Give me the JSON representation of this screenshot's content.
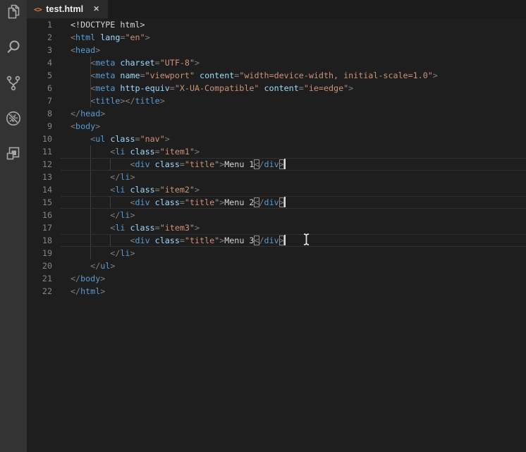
{
  "activity_bar": {
    "icons": [
      {
        "name": "explorer-icon"
      },
      {
        "name": "search-icon"
      },
      {
        "name": "source-control-icon"
      },
      {
        "name": "debug-icon"
      },
      {
        "name": "extensions-icon"
      }
    ]
  },
  "tab_bar": {
    "tabs": [
      {
        "label": "test.html",
        "icon_glyph": "<>",
        "close_glyph": "✕",
        "active": true
      }
    ]
  },
  "pointer": {
    "shape": "text-i-beam"
  },
  "colors": {
    "editor_bg": "#1e1e1e",
    "activity_bar_bg": "#333333",
    "tabbar_bg": "#1b1b1c",
    "active_tab_bg": "#2a2a2b",
    "tag": "#569cd6",
    "attribute": "#9cdcfe",
    "string": "#ce9178",
    "punctuation": "#808080",
    "text": "#d4d4d4",
    "line_number": "#858585"
  },
  "editor": {
    "language": "html",
    "lines": [
      {
        "n": 1,
        "guides": [],
        "active": false,
        "tokens": [
          {
            "t": "<!DOCTYPE html>",
            "c": "plain"
          }
        ]
      },
      {
        "n": 2,
        "guides": [],
        "active": false,
        "tokens": [
          {
            "t": "<",
            "c": "punc"
          },
          {
            "t": "html",
            "c": "tag"
          },
          {
            "t": " ",
            "c": "plain"
          },
          {
            "t": "lang",
            "c": "attr"
          },
          {
            "t": "=",
            "c": "punc"
          },
          {
            "t": "\"en\"",
            "c": "str"
          },
          {
            "t": ">",
            "c": "punc"
          }
        ]
      },
      {
        "n": 3,
        "guides": [],
        "active": false,
        "tokens": [
          {
            "t": "<",
            "c": "punc"
          },
          {
            "t": "head",
            "c": "tag"
          },
          {
            "t": ">",
            "c": "punc"
          }
        ]
      },
      {
        "n": 4,
        "guides": [
          1
        ],
        "active": false,
        "tokens": [
          {
            "t": "    ",
            "c": "plain"
          },
          {
            "t": "<",
            "c": "punc"
          },
          {
            "t": "meta",
            "c": "tag"
          },
          {
            "t": " ",
            "c": "plain"
          },
          {
            "t": "charset",
            "c": "attr"
          },
          {
            "t": "=",
            "c": "punc"
          },
          {
            "t": "\"UTF-8\"",
            "c": "str"
          },
          {
            "t": ">",
            "c": "punc"
          }
        ]
      },
      {
        "n": 5,
        "guides": [
          1
        ],
        "active": false,
        "tokens": [
          {
            "t": "    ",
            "c": "plain"
          },
          {
            "t": "<",
            "c": "punc"
          },
          {
            "t": "meta",
            "c": "tag"
          },
          {
            "t": " ",
            "c": "plain"
          },
          {
            "t": "name",
            "c": "attr"
          },
          {
            "t": "=",
            "c": "punc"
          },
          {
            "t": "\"viewport\"",
            "c": "str"
          },
          {
            "t": " ",
            "c": "plain"
          },
          {
            "t": "content",
            "c": "attr"
          },
          {
            "t": "=",
            "c": "punc"
          },
          {
            "t": "\"width=device-width, initial-scale=1.0\"",
            "c": "str"
          },
          {
            "t": ">",
            "c": "punc"
          }
        ]
      },
      {
        "n": 6,
        "guides": [
          1
        ],
        "active": false,
        "tokens": [
          {
            "t": "    ",
            "c": "plain"
          },
          {
            "t": "<",
            "c": "punc"
          },
          {
            "t": "meta",
            "c": "tag"
          },
          {
            "t": " ",
            "c": "plain"
          },
          {
            "t": "http-equiv",
            "c": "attr"
          },
          {
            "t": "=",
            "c": "punc"
          },
          {
            "t": "\"X-UA-Compatible\"",
            "c": "str"
          },
          {
            "t": " ",
            "c": "plain"
          },
          {
            "t": "content",
            "c": "attr"
          },
          {
            "t": "=",
            "c": "punc"
          },
          {
            "t": "\"ie=edge\"",
            "c": "str"
          },
          {
            "t": ">",
            "c": "punc"
          }
        ]
      },
      {
        "n": 7,
        "guides": [
          1
        ],
        "active": false,
        "tokens": [
          {
            "t": "    ",
            "c": "plain"
          },
          {
            "t": "<",
            "c": "punc"
          },
          {
            "t": "title",
            "c": "tag"
          },
          {
            "t": "></",
            "c": "punc"
          },
          {
            "t": "title",
            "c": "tag"
          },
          {
            "t": ">",
            "c": "punc"
          }
        ]
      },
      {
        "n": 8,
        "guides": [],
        "active": false,
        "tokens": [
          {
            "t": "</",
            "c": "punc"
          },
          {
            "t": "head",
            "c": "tag"
          },
          {
            "t": ">",
            "c": "punc"
          }
        ]
      },
      {
        "n": 9,
        "guides": [],
        "active": false,
        "tokens": [
          {
            "t": "<",
            "c": "punc"
          },
          {
            "t": "body",
            "c": "tag"
          },
          {
            "t": ">",
            "c": "punc"
          }
        ]
      },
      {
        "n": 10,
        "guides": [],
        "active": false,
        "tokens": [
          {
            "t": "    ",
            "c": "plain"
          },
          {
            "t": "<",
            "c": "punc"
          },
          {
            "t": "ul",
            "c": "tag"
          },
          {
            "t": " ",
            "c": "plain"
          },
          {
            "t": "class",
            "c": "attr"
          },
          {
            "t": "=",
            "c": "punc"
          },
          {
            "t": "\"nav\"",
            "c": "str"
          },
          {
            "t": ">",
            "c": "punc"
          }
        ]
      },
      {
        "n": 11,
        "guides": [
          1
        ],
        "active": false,
        "tokens": [
          {
            "t": "        ",
            "c": "plain"
          },
          {
            "t": "<",
            "c": "punc"
          },
          {
            "t": "li",
            "c": "tag"
          },
          {
            "t": " ",
            "c": "plain"
          },
          {
            "t": "class",
            "c": "attr"
          },
          {
            "t": "=",
            "c": "punc"
          },
          {
            "t": "\"item1\"",
            "c": "str"
          },
          {
            "t": ">",
            "c": "punc"
          }
        ]
      },
      {
        "n": 12,
        "guides": [
          1,
          2
        ],
        "active": true,
        "tokens": [
          {
            "t": "            ",
            "c": "plain"
          },
          {
            "t": "<",
            "c": "punc"
          },
          {
            "t": "div",
            "c": "tag"
          },
          {
            "t": " ",
            "c": "plain"
          },
          {
            "t": "class",
            "c": "attr"
          },
          {
            "t": "=",
            "c": "punc"
          },
          {
            "t": "\"title\"",
            "c": "str"
          },
          {
            "t": ">",
            "c": "punc"
          },
          {
            "t": "Menu 1",
            "c": "plain"
          },
          {
            "t": "<",
            "c": "punc",
            "box": true
          },
          {
            "t": "/",
            "c": "punc"
          },
          {
            "t": "div",
            "c": "tag"
          },
          {
            "t": ">",
            "c": "punc",
            "box": true,
            "cur": true
          }
        ]
      },
      {
        "n": 13,
        "guides": [
          1
        ],
        "active": false,
        "tokens": [
          {
            "t": "        ",
            "c": "plain"
          },
          {
            "t": "</",
            "c": "punc"
          },
          {
            "t": "li",
            "c": "tag"
          },
          {
            "t": ">",
            "c": "punc"
          }
        ]
      },
      {
        "n": 14,
        "guides": [
          1
        ],
        "active": false,
        "tokens": [
          {
            "t": "        ",
            "c": "plain"
          },
          {
            "t": "<",
            "c": "punc"
          },
          {
            "t": "li",
            "c": "tag"
          },
          {
            "t": " ",
            "c": "plain"
          },
          {
            "t": "class",
            "c": "attr"
          },
          {
            "t": "=",
            "c": "punc"
          },
          {
            "t": "\"item2\"",
            "c": "str"
          },
          {
            "t": ">",
            "c": "punc"
          }
        ]
      },
      {
        "n": 15,
        "guides": [
          1,
          2
        ],
        "active": true,
        "tokens": [
          {
            "t": "            ",
            "c": "plain"
          },
          {
            "t": "<",
            "c": "punc"
          },
          {
            "t": "div",
            "c": "tag"
          },
          {
            "t": " ",
            "c": "plain"
          },
          {
            "t": "class",
            "c": "attr"
          },
          {
            "t": "=",
            "c": "punc"
          },
          {
            "t": "\"title\"",
            "c": "str"
          },
          {
            "t": ">",
            "c": "punc"
          },
          {
            "t": "Menu 2",
            "c": "plain"
          },
          {
            "t": "<",
            "c": "punc",
            "box": true
          },
          {
            "t": "/",
            "c": "punc"
          },
          {
            "t": "div",
            "c": "tag"
          },
          {
            "t": ">",
            "c": "punc",
            "box": true,
            "cur": true
          }
        ]
      },
      {
        "n": 16,
        "guides": [
          1
        ],
        "active": false,
        "tokens": [
          {
            "t": "        ",
            "c": "plain"
          },
          {
            "t": "</",
            "c": "punc"
          },
          {
            "t": "li",
            "c": "tag"
          },
          {
            "t": ">",
            "c": "punc"
          }
        ]
      },
      {
        "n": 17,
        "guides": [
          1
        ],
        "active": false,
        "tokens": [
          {
            "t": "        ",
            "c": "plain"
          },
          {
            "t": "<",
            "c": "punc"
          },
          {
            "t": "li",
            "c": "tag"
          },
          {
            "t": " ",
            "c": "plain"
          },
          {
            "t": "class",
            "c": "attr"
          },
          {
            "t": "=",
            "c": "punc"
          },
          {
            "t": "\"item3\"",
            "c": "str"
          },
          {
            "t": ">",
            "c": "punc"
          }
        ]
      },
      {
        "n": 18,
        "guides": [
          1,
          2
        ],
        "active": true,
        "tokens": [
          {
            "t": "            ",
            "c": "plain"
          },
          {
            "t": "<",
            "c": "punc"
          },
          {
            "t": "div",
            "c": "tag"
          },
          {
            "t": " ",
            "c": "plain"
          },
          {
            "t": "class",
            "c": "attr"
          },
          {
            "t": "=",
            "c": "punc"
          },
          {
            "t": "\"title\"",
            "c": "str"
          },
          {
            "t": ">",
            "c": "punc"
          },
          {
            "t": "Menu 3",
            "c": "plain"
          },
          {
            "t": "<",
            "c": "punc",
            "box": true
          },
          {
            "t": "/",
            "c": "punc"
          },
          {
            "t": "div",
            "c": "tag"
          },
          {
            "t": ">",
            "c": "punc",
            "box": true,
            "cur": true
          }
        ]
      },
      {
        "n": 19,
        "guides": [
          1
        ],
        "active": false,
        "tokens": [
          {
            "t": "        ",
            "c": "plain"
          },
          {
            "t": "</",
            "c": "punc"
          },
          {
            "t": "li",
            "c": "tag"
          },
          {
            "t": ">",
            "c": "punc"
          }
        ]
      },
      {
        "n": 20,
        "guides": [],
        "active": false,
        "tokens": [
          {
            "t": "    ",
            "c": "plain"
          },
          {
            "t": "</",
            "c": "punc"
          },
          {
            "t": "ul",
            "c": "tag"
          },
          {
            "t": ">",
            "c": "punc"
          }
        ]
      },
      {
        "n": 21,
        "guides": [],
        "active": false,
        "tokens": [
          {
            "t": "</",
            "c": "punc"
          },
          {
            "t": "body",
            "c": "tag"
          },
          {
            "t": ">",
            "c": "punc"
          }
        ]
      },
      {
        "n": 22,
        "guides": [],
        "active": false,
        "tokens": [
          {
            "t": "</",
            "c": "punc"
          },
          {
            "t": "html",
            "c": "tag"
          },
          {
            "t": ">",
            "c": "punc"
          }
        ]
      }
    ]
  }
}
